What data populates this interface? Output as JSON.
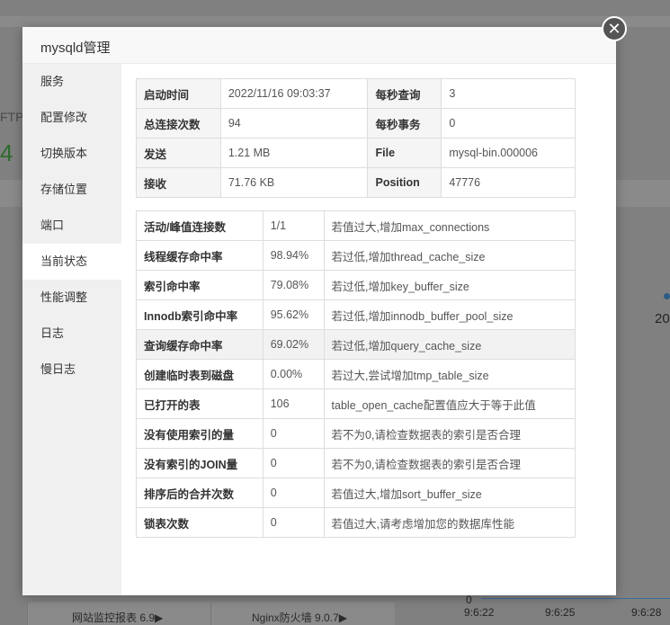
{
  "background": {
    "ftp_text": "FTP",
    "count_text": "4",
    "year_text": "20",
    "bottom_cards": [
      "网站监控报表 6.9▶",
      "Nginx防火墙 9.0.7▶"
    ],
    "chart_zero": "0",
    "chart_ticks": [
      "9:6:22",
      "9:6:25",
      "9:6:28"
    ]
  },
  "modal": {
    "title": "mysqld管理",
    "close_symbol": "✕"
  },
  "sidebar": {
    "items": [
      {
        "label": "服务"
      },
      {
        "label": "配置修改"
      },
      {
        "label": "切换版本"
      },
      {
        "label": "存储位置"
      },
      {
        "label": "端口"
      },
      {
        "label": "当前状态"
      },
      {
        "label": "性能调整"
      },
      {
        "label": "日志"
      },
      {
        "label": "慢日志"
      }
    ],
    "active_index": 5
  },
  "status_table": [
    [
      "启动时间",
      "2022/11/16 09:03:37",
      "每秒查询",
      "3"
    ],
    [
      "总连接次数",
      "94",
      "每秒事务",
      "0"
    ],
    [
      "发送",
      "1.21 MB",
      "File",
      "mysql-bin.000006"
    ],
    [
      "接收",
      "71.76 KB",
      "Position",
      "47776"
    ]
  ],
  "metrics_table": [
    [
      "活动/峰值连接数",
      "1/1",
      "若值过大,增加max_connections"
    ],
    [
      "线程缓存命中率",
      "98.94%",
      "若过低,增加thread_cache_size"
    ],
    [
      "索引命中率",
      "79.08%",
      "若过低,增加key_buffer_size"
    ],
    [
      "Innodb索引命中率",
      "95.62%",
      "若过低,增加innodb_buffer_pool_size"
    ],
    [
      "查询缓存命中率",
      "69.02%",
      "若过低,增加query_cache_size"
    ],
    [
      "创建临时表到磁盘",
      "0.00%",
      "若过大,尝试增加tmp_table_size"
    ],
    [
      "已打开的表",
      "106",
      "table_open_cache配置值应大于等于此值"
    ],
    [
      "没有使用索引的量",
      "0",
      "若不为0,请检查数据表的索引是否合理"
    ],
    [
      "没有索引的JOIN量",
      "0",
      "若不为0,请检查数据表的索引是否合理"
    ],
    [
      "排序后的合并次数",
      "0",
      "若值过大,增加sort_buffer_size"
    ],
    [
      "锁表次数",
      "0",
      "若值过大,请考虑增加您的数据库性能"
    ]
  ],
  "highlighted_metric_row": 4
}
